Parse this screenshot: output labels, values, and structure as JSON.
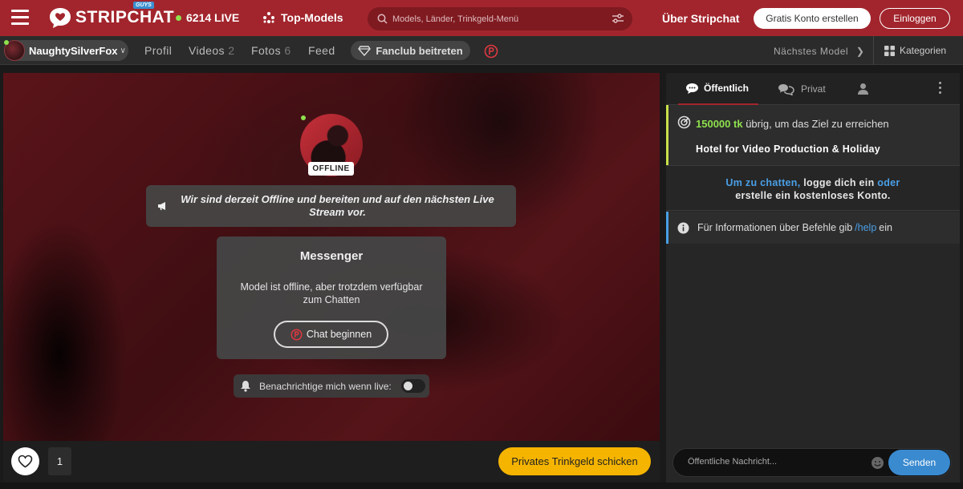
{
  "header": {
    "brand": "STRIPCHAT",
    "brand_tag": "GUYS",
    "live_count": "6214 LIVE",
    "top_models": "Top-Models",
    "search_placeholder": "Models, Länder, Trinkgeld-Menü",
    "about": "Über Stripchat",
    "signup": "Gratis Konto erstellen",
    "login": "Einloggen",
    "accent_color": "#a2252d"
  },
  "subnav": {
    "username": "NaughtySilverFox",
    "profile": "Profil",
    "videos_label": "Videos",
    "videos_count": "2",
    "photos_label": "Fotos",
    "photos_count": "6",
    "feed": "Feed",
    "fanclub": "Fanclub beitreten",
    "next_model": "Nächstes Model",
    "categories": "Kategorien"
  },
  "stream": {
    "status_badge": "OFFLINE",
    "offline_message": "Wir sind derzeit Offline und bereiten und auf den nächsten Live Stream vor.",
    "messenger_title": "Messenger",
    "messenger_desc": "Model ist offline, aber trotzdem verfügbar zum Chatten",
    "chat_button": "Chat beginnen",
    "notify_label": "Benachrichtige mich wenn live:",
    "like_count": "1",
    "tip_button": "Privates Trinkgeld schicken"
  },
  "chat": {
    "tab_public": "Öffentlich",
    "tab_private": "Privat",
    "goal_amount": "150000 tk",
    "goal_text": "übrig, um das Ziel zu erreichen",
    "goal_title": "Hotel for Video Production & Holiday",
    "login_link1": "Um zu chatten,",
    "login_text1": "logge dich ein",
    "login_link2": "oder",
    "login_text2": "erstelle ein kostenloses Konto.",
    "help_prefix": "Für Informationen über Befehle gib",
    "help_cmd": "/help",
    "help_suffix": "ein",
    "input_placeholder": "Öffentliche Nachricht...",
    "send": "Senden"
  }
}
